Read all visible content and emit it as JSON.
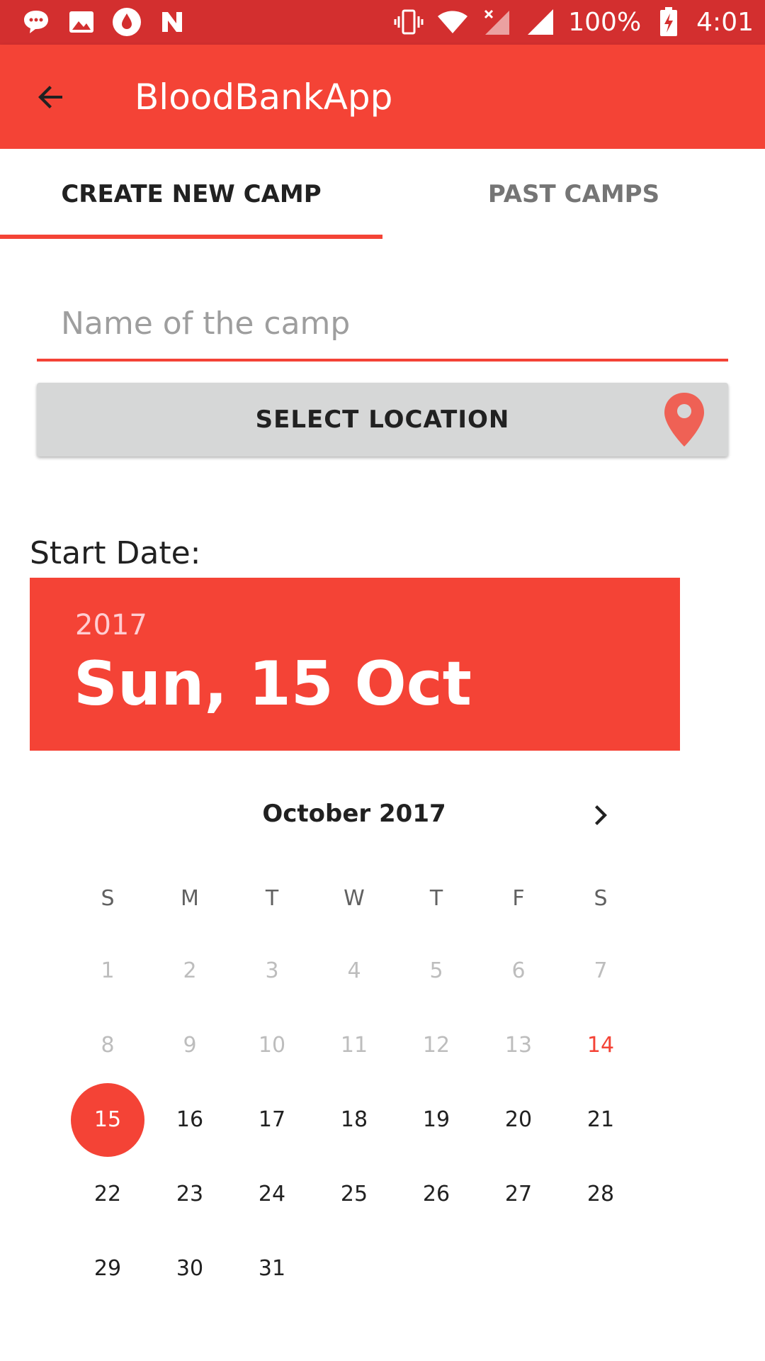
{
  "status_bar": {
    "battery": "100%",
    "time": "4:01"
  },
  "app_bar": {
    "title": "BloodBankApp"
  },
  "tabs": [
    {
      "label": "CREATE NEW CAMP",
      "active": true
    },
    {
      "label": "PAST CAMPS",
      "active": false
    }
  ],
  "form": {
    "camp_name_placeholder": "Name of the camp",
    "camp_name_value": "",
    "select_location_label": "SELECT LOCATION",
    "start_date_label": "Start Date:"
  },
  "date_picker": {
    "year": "2017",
    "selected_date_text": "Sun, 15 Oct",
    "month_title": "October 2017",
    "weekdays": [
      "S",
      "M",
      "T",
      "W",
      "T",
      "F",
      "S"
    ],
    "first_weekday_index": 0,
    "days": [
      "1",
      "2",
      "3",
      "4",
      "5",
      "6",
      "7",
      "8",
      "9",
      "10",
      "11",
      "12",
      "13",
      "14",
      "15",
      "16",
      "17",
      "18",
      "19",
      "20",
      "21",
      "22",
      "23",
      "24",
      "25",
      "26",
      "27",
      "28",
      "29",
      "30",
      "31"
    ],
    "disabled_before": 14,
    "today": 14,
    "selected": 15
  },
  "colors": {
    "primary": "#f44336",
    "primary_dark": "#d32f2f",
    "button_grey": "#d6d7d7",
    "disabled_text": "#bdbdbd"
  },
  "icons": {
    "back": "arrow-left",
    "location": "map-pin",
    "next_month": "chevron-right"
  }
}
